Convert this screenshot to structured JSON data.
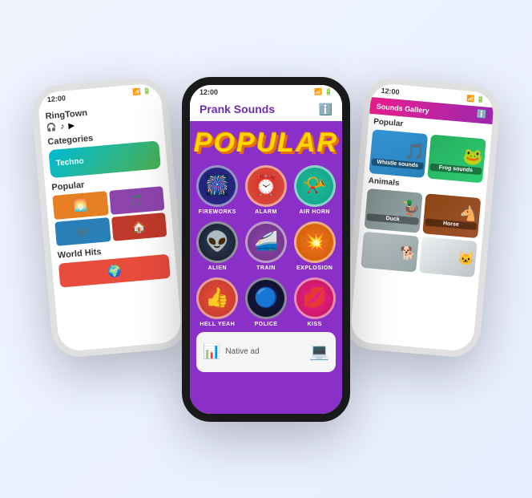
{
  "left_phone": {
    "status_time": "12:00",
    "app_name": "RingTown",
    "icons": [
      "🎧",
      "♪",
      "▶"
    ],
    "categories_title": "Categories",
    "techno_label": "Techno",
    "popular_title": "Popular",
    "world_hits_title": "World Hits",
    "popular_items": [
      {
        "emoji": "🌅",
        "bg": "#e67e22"
      },
      {
        "emoji": "🎵",
        "bg": "#8e44ad"
      },
      {
        "emoji": "🎶",
        "bg": "#2980b9"
      },
      {
        "emoji": "🏠",
        "bg": "#c0392b"
      }
    ]
  },
  "center_phone": {
    "status_time": "12:00",
    "app_title": "Prank Sounds",
    "popular_label": "POPULAR",
    "sounds": [
      {
        "label": "FIREWORKS",
        "emoji": "🎆",
        "bg_class": "bg-fireworks"
      },
      {
        "label": "ALARM",
        "emoji": "⏰",
        "bg_class": "bg-alarm"
      },
      {
        "label": "AIR HORN",
        "emoji": "📯",
        "bg_class": "bg-airhorn"
      },
      {
        "label": "ALIEN",
        "emoji": "👽",
        "bg_class": "bg-alien"
      },
      {
        "label": "TRAIN",
        "emoji": "🚄",
        "bg_class": "bg-train"
      },
      {
        "label": "EXPLOSION",
        "emoji": "💥",
        "bg_class": "bg-explosion"
      },
      {
        "label": "HELL YEAH",
        "emoji": "👍",
        "bg_class": "bg-hellyeah"
      },
      {
        "label": "POLICE",
        "emoji": "🔵",
        "bg_class": "bg-police"
      },
      {
        "label": "KISS",
        "emoji": "💋",
        "bg_class": "bg-kiss"
      }
    ],
    "ad_text": "Native ad",
    "ad_emoji": "💻"
  },
  "right_phone": {
    "status_time": "12:00",
    "header_title": "Sounds Gallery",
    "popular_section": "Popular",
    "animals_section": "Animals",
    "popular_items": [
      {
        "label": "Whistle sounds",
        "emoji": "🎵",
        "bg": "#3498db"
      },
      {
        "label": "Frog sounds",
        "emoji": "🐸",
        "bg": "#27ae60"
      }
    ],
    "animal_items": [
      {
        "label": "Duck",
        "emoji": "🦆",
        "bg": "#7f8c8d"
      },
      {
        "label": "Horse",
        "emoji": "🐴",
        "bg": "#8B4513"
      },
      {
        "label": "",
        "emoji": "🐕",
        "bg": "#95a5a6"
      },
      {
        "label": "",
        "emoji": "🐱",
        "bg": "#bdc3c7"
      }
    ]
  }
}
